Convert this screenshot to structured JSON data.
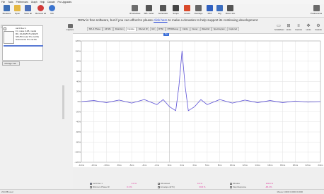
{
  "menu": [
    "File",
    "Tools",
    "Preferences",
    "Graph",
    "Help",
    "Donate",
    "Pro Upgrades"
  ],
  "toolbar_left": [
    {
      "label": "Measure",
      "icon": "measure-icon",
      "color": "#3d6fb6"
    },
    {
      "label": "Open",
      "icon": "folder-icon",
      "color": "#e5b844"
    },
    {
      "label": "Save all",
      "icon": "save-icon",
      "color": "#4b6fb9"
    },
    {
      "label": "Remove all",
      "icon": "remove-icon",
      "color": "#d23b3b"
    },
    {
      "label": "Info",
      "icon": "info-icon",
      "color": "#3b74cf"
    }
  ],
  "toolbar_right": [
    {
      "label": "IR windows",
      "icon": "ir-windows-icon",
      "color": "#6c6c6c"
    },
    {
      "label": "SPL meter",
      "icon": "spl-meter-icon",
      "color": "#555555"
    },
    {
      "label": "Generator",
      "icon": "generator-icon",
      "color": "#555555"
    },
    {
      "label": "Scope",
      "icon": "scope-icon",
      "color": "#444444"
    },
    {
      "label": "Levels",
      "icon": "levels-icon",
      "color": "#d9492a"
    },
    {
      "label": "Overlays",
      "icon": "overlays-icon",
      "color": "#666666"
    },
    {
      "label": "RTA",
      "icon": "rta-icon",
      "color": "#3060c0"
    },
    {
      "label": "EQ",
      "icon": "eq-icon",
      "color": "#3b6dbf"
    },
    {
      "label": "Room sim",
      "icon": "room-sim-icon",
      "color": "#555555"
    }
  ],
  "preferences_label": "Preferences",
  "cal_tab": "Calibration",
  "measurement": {
    "name": "cal 0 Rev 1",
    "line1": "Fri, noise 0 dB, model",
    "line2": "R0, 1/1/2025 70.2/2025",
    "line3": "SPL/50 meter Pro cal file",
    "line4": "Sosamente Pro cal file"
  },
  "change_cal_label": "Change Cal...",
  "banner": {
    "pre": "REW is free software, but if you can afford to please ",
    "link": "click here",
    "post": " to make a donation to help support its continuing development"
  },
  "capture_label": "Capture",
  "tabs": [
    "SPL & Phase",
    "All SPL",
    "Distortion",
    "Impulse",
    "Filtered IR",
    "GD",
    "RT60",
    "RT60/Decay",
    "Clarity",
    "Decay",
    "Waterfall",
    "Spectrogram",
    "Captured"
  ],
  "active_tab": "Impulse",
  "right_tools": [
    {
      "label": "Scroll/Zoom",
      "icon": "scroll-icon"
    },
    {
      "label": "Limits",
      "icon": "limits-icon"
    },
    {
      "label": "Controls",
      "icon": "controls-icon"
    },
    {
      "label": "Limits",
      "icon": "limits-arrow-icon"
    },
    {
      "label": "Controls",
      "icon": "controls-gear-icon"
    }
  ],
  "range_button_label": "Tce",
  "bottom_legend": [
    {
      "name": "cal 0 Rev 1",
      "value": "0.0 %",
      "checked": true
    },
    {
      "name": "Minimum Phase IR",
      "value": "0.0 %",
      "checked": false
    },
    {
      "name": "Windowed",
      "value": "0.0 %",
      "checked": false
    },
    {
      "name": "Envelope (ETC)",
      "value": "93.6 %",
      "checked": false
    },
    {
      "name": "Window",
      "value": "100.0 %",
      "checked": false
    },
    {
      "name": "Step Response",
      "value": "-95.4 %",
      "checked": false
    }
  ],
  "status_left": "234 MB used",
  "status_right": "Mouse 0.0000 0.0000 0.0000",
  "line_color": "#5a4fd6",
  "chart_data": {
    "type": "line",
    "title": "",
    "xlabel": "",
    "ylabel": "",
    "y_ticks": [
      "120%",
      "100%",
      "80%",
      "60%",
      "40%",
      "20%",
      "0%",
      "-20%",
      "-40%",
      "-60%",
      "-80%",
      "-100%",
      "-120%"
    ],
    "x_ticks": [
      "-14ms",
      "-12ms",
      "-10ms",
      "-8ms",
      "-6ms",
      "-4ms",
      "-2ms",
      "0ms",
      "2ms",
      "4ms",
      "6ms",
      "8ms",
      "10ms",
      "12ms",
      "14ms",
      "16ms",
      "18ms",
      "20ms",
      "22ms",
      "24ms"
    ],
    "ylim": [
      -120,
      120
    ],
    "grid": true,
    "series": [
      {
        "name": "cal 0 Rev 1",
        "description": "sinc-shaped impulse, peak near 2ms",
        "x": [
          -14,
          -12,
          -10,
          -8,
          -6,
          -4,
          -2,
          -1,
          0,
          1,
          1.5,
          2,
          2.5,
          3,
          4,
          5,
          6,
          8,
          10,
          12,
          14,
          16,
          18,
          20,
          22,
          24
        ],
        "y": [
          0,
          2,
          -2,
          3,
          -3,
          4,
          -6,
          4,
          -10,
          -18,
          30,
          100,
          30,
          -18,
          -10,
          4,
          -6,
          4,
          -3,
          3,
          -2,
          2,
          -2,
          1,
          -1,
          0
        ]
      }
    ]
  }
}
